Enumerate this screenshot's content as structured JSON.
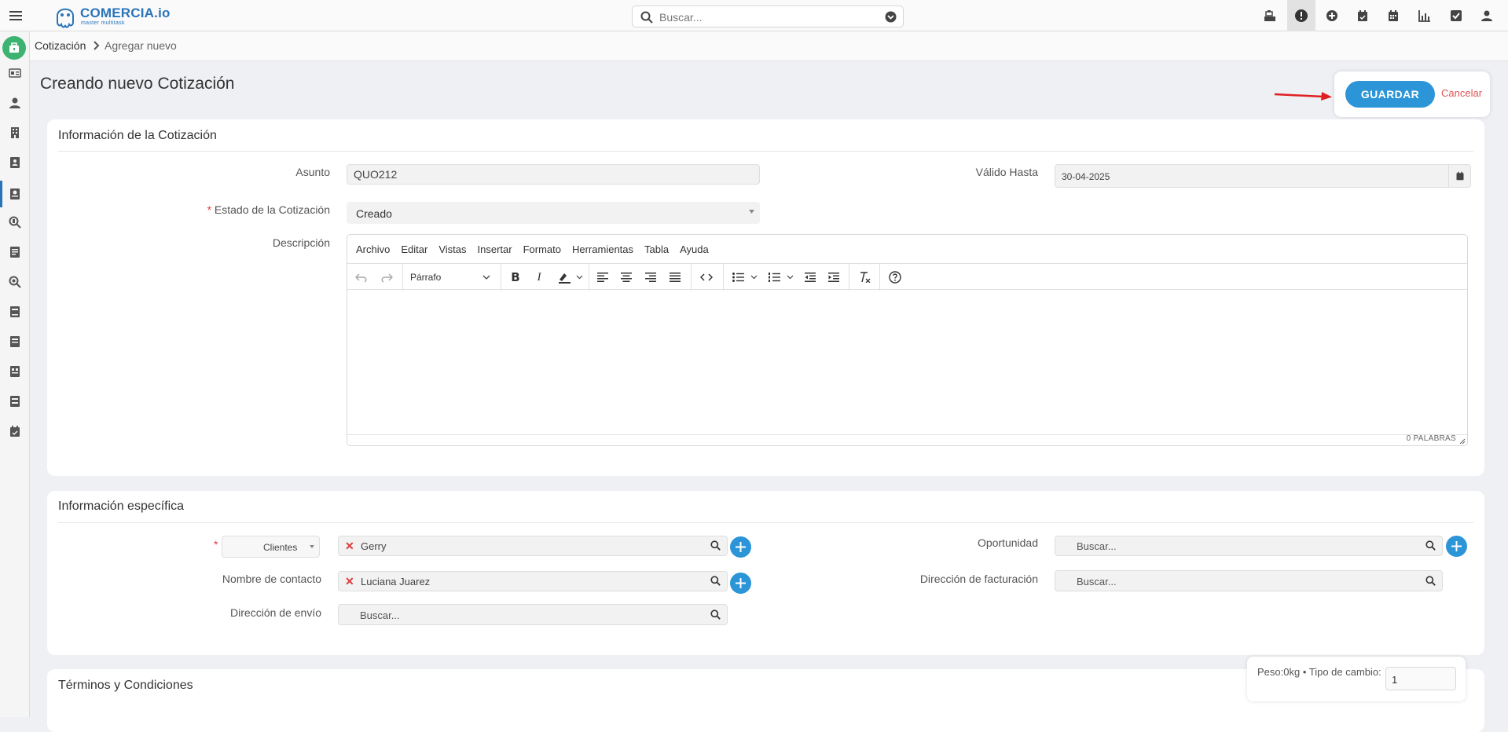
{
  "app": {
    "brand": "COMERCIA.io",
    "tagline": "master multitask",
    "search_placeholder": "Buscar..."
  },
  "breadcrumb": {
    "section": "Cotización",
    "current": "Agregar nuevo"
  },
  "page": {
    "title": "Creando nuevo Cotización",
    "save_label": "GUARDAR",
    "cancel_label": "Cancelar"
  },
  "quote_info": {
    "title": "Información de la Cotización",
    "subject_label": "Asunto",
    "subject_value": "QUO212",
    "valid_until_label": "Válido Hasta",
    "valid_until_value": "30-04-2025",
    "status_label": "Estado de la Cotización",
    "status_value": "Creado",
    "description_label": "Descripción"
  },
  "editor": {
    "menu": [
      "Archivo",
      "Editar",
      "Vistas",
      "Insertar",
      "Formato",
      "Herramientas",
      "Tabla",
      "Ayuda"
    ],
    "block_format": "Párrafo",
    "word_count": "0 PALABRAS"
  },
  "specific_info": {
    "title": "Información específica",
    "related_type": "Clientes",
    "related_value": "Gerry",
    "contact_label": "Nombre de contacto",
    "contact_value": "Luciana Juarez",
    "shipping_label": "Dirección de envío",
    "shipping_placeholder": "Buscar...",
    "opportunity_label": "Oportunidad",
    "opportunity_placeholder": "Buscar...",
    "billing_label": "Dirección de facturación",
    "billing_placeholder": "Buscar..."
  },
  "terms": {
    "title": "Términos y Condiciones"
  },
  "footer_info": {
    "weight_text": "Peso:0kg • Tipo de cambio:",
    "exchange_rate": "1"
  },
  "colors": {
    "primary": "#2b95d8",
    "brand": "#2a74b8",
    "danger": "#e05555",
    "home": "#3cb371"
  }
}
